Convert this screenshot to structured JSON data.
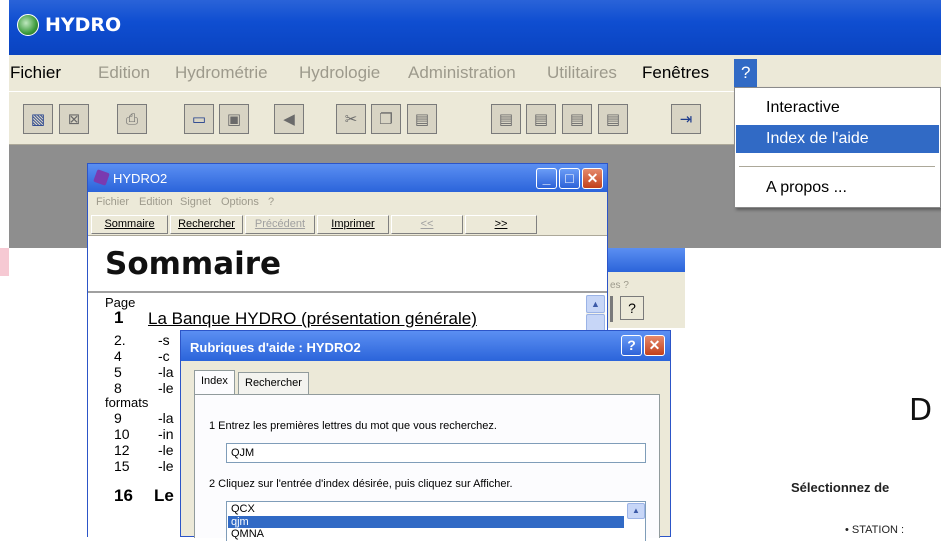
{
  "hydro": {
    "title": "HYDRO",
    "menu": [
      "Fichier",
      "Edition",
      "Hydrométrie",
      "Hydrologie",
      "Administration",
      "Utilitaires",
      "Fenêtres",
      "?"
    ],
    "help_menu": [
      "Interactive",
      "Index de l'aide",
      "A propos ..."
    ],
    "toolbar_icons": [
      "map-icon",
      "close-map-icon",
      "print-icon",
      "open-folder-icon",
      "save-icon",
      "back-icon",
      "cut-icon",
      "copy-icon",
      "paste-icon",
      "report-icon",
      "report-icon",
      "report-icon",
      "report-icon",
      "exit-door-icon"
    ]
  },
  "hydro2": {
    "title": "HYDRO2",
    "menu": [
      "Fichier",
      "Edition",
      "Signet",
      "Options",
      "?"
    ],
    "buttons": [
      "Sommaire",
      "Rechercher",
      "Précédent",
      "Imprimer",
      "<<",
      ">>"
    ],
    "heading": "Sommaire",
    "content": {
      "page_label": "Page",
      "rows": [
        {
          "num": "1",
          "text": "La Banque HYDRO (présentation générale)"
        },
        {
          "num": "2.",
          "text": "-s"
        },
        {
          "num": "4",
          "text": "-c"
        },
        {
          "num": "5",
          "text": "-la"
        },
        {
          "num": "8",
          "text": "-le"
        },
        {
          "num": "formats",
          "text": ""
        },
        {
          "num": "9",
          "text": "-la"
        },
        {
          "num": "10",
          "text": "-in"
        },
        {
          "num": "12",
          "text": "-le"
        },
        {
          "num": "15",
          "text": "-le"
        },
        {
          "num": "16",
          "text": "Le"
        }
      ]
    }
  },
  "bgwin": {
    "menu_fragment": "es ?",
    "help_button": "?"
  },
  "rubriques": {
    "title": "Rubriques d'aide : HYDRO2",
    "tabs": [
      "Index",
      "Rechercher"
    ],
    "step1": "1  Entrez les premières lettres du mot que vous recherchez.",
    "search_value": "QJM",
    "step2": "2  Cliquez sur l'entrée d'index désirée, puis cliquez sur Afficher.",
    "list": [
      "QCX",
      "qjm",
      "QMNA"
    ]
  },
  "right_page": {
    "letter": "D",
    "select_text": "Sélectionnez de",
    "station_text": "• STATION :"
  },
  "colors": {
    "xp_blue": "#0f4ed1",
    "highlight": "#316ac5",
    "menu_bg": "#ece9d8",
    "workspace": "#8e8e8e"
  }
}
